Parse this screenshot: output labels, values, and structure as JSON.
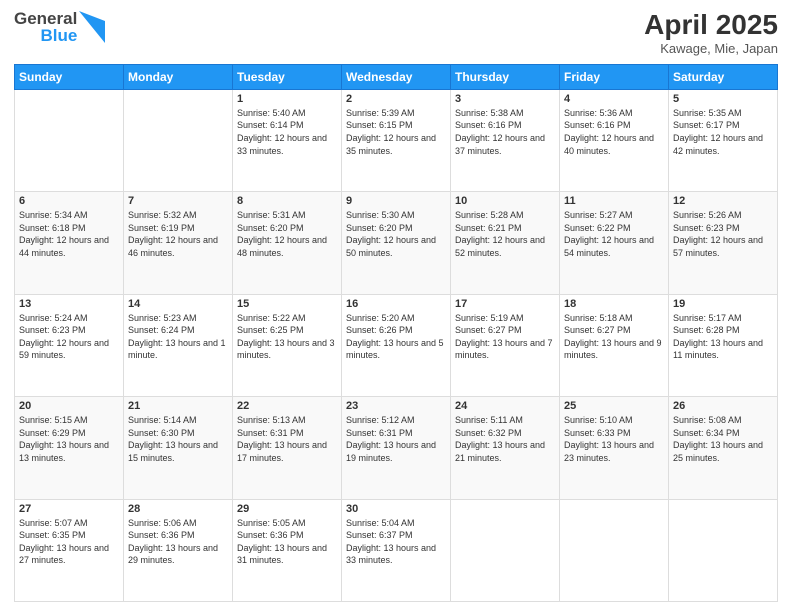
{
  "logo": {
    "general": "General",
    "blue": "Blue"
  },
  "title": "April 2025",
  "subtitle": "Kawage, Mie, Japan",
  "weekdays": [
    "Sunday",
    "Monday",
    "Tuesday",
    "Wednesday",
    "Thursday",
    "Friday",
    "Saturday"
  ],
  "weeks": [
    [
      {
        "day": "",
        "sunrise": "",
        "sunset": "",
        "daylight": ""
      },
      {
        "day": "",
        "sunrise": "",
        "sunset": "",
        "daylight": ""
      },
      {
        "day": "1",
        "sunrise": "Sunrise: 5:40 AM",
        "sunset": "Sunset: 6:14 PM",
        "daylight": "Daylight: 12 hours and 33 minutes."
      },
      {
        "day": "2",
        "sunrise": "Sunrise: 5:39 AM",
        "sunset": "Sunset: 6:15 PM",
        "daylight": "Daylight: 12 hours and 35 minutes."
      },
      {
        "day": "3",
        "sunrise": "Sunrise: 5:38 AM",
        "sunset": "Sunset: 6:16 PM",
        "daylight": "Daylight: 12 hours and 37 minutes."
      },
      {
        "day": "4",
        "sunrise": "Sunrise: 5:36 AM",
        "sunset": "Sunset: 6:16 PM",
        "daylight": "Daylight: 12 hours and 40 minutes."
      },
      {
        "day": "5",
        "sunrise": "Sunrise: 5:35 AM",
        "sunset": "Sunset: 6:17 PM",
        "daylight": "Daylight: 12 hours and 42 minutes."
      }
    ],
    [
      {
        "day": "6",
        "sunrise": "Sunrise: 5:34 AM",
        "sunset": "Sunset: 6:18 PM",
        "daylight": "Daylight: 12 hours and 44 minutes."
      },
      {
        "day": "7",
        "sunrise": "Sunrise: 5:32 AM",
        "sunset": "Sunset: 6:19 PM",
        "daylight": "Daylight: 12 hours and 46 minutes."
      },
      {
        "day": "8",
        "sunrise": "Sunrise: 5:31 AM",
        "sunset": "Sunset: 6:20 PM",
        "daylight": "Daylight: 12 hours and 48 minutes."
      },
      {
        "day": "9",
        "sunrise": "Sunrise: 5:30 AM",
        "sunset": "Sunset: 6:20 PM",
        "daylight": "Daylight: 12 hours and 50 minutes."
      },
      {
        "day": "10",
        "sunrise": "Sunrise: 5:28 AM",
        "sunset": "Sunset: 6:21 PM",
        "daylight": "Daylight: 12 hours and 52 minutes."
      },
      {
        "day": "11",
        "sunrise": "Sunrise: 5:27 AM",
        "sunset": "Sunset: 6:22 PM",
        "daylight": "Daylight: 12 hours and 54 minutes."
      },
      {
        "day": "12",
        "sunrise": "Sunrise: 5:26 AM",
        "sunset": "Sunset: 6:23 PM",
        "daylight": "Daylight: 12 hours and 57 minutes."
      }
    ],
    [
      {
        "day": "13",
        "sunrise": "Sunrise: 5:24 AM",
        "sunset": "Sunset: 6:23 PM",
        "daylight": "Daylight: 12 hours and 59 minutes."
      },
      {
        "day": "14",
        "sunrise": "Sunrise: 5:23 AM",
        "sunset": "Sunset: 6:24 PM",
        "daylight": "Daylight: 13 hours and 1 minute."
      },
      {
        "day": "15",
        "sunrise": "Sunrise: 5:22 AM",
        "sunset": "Sunset: 6:25 PM",
        "daylight": "Daylight: 13 hours and 3 minutes."
      },
      {
        "day": "16",
        "sunrise": "Sunrise: 5:20 AM",
        "sunset": "Sunset: 6:26 PM",
        "daylight": "Daylight: 13 hours and 5 minutes."
      },
      {
        "day": "17",
        "sunrise": "Sunrise: 5:19 AM",
        "sunset": "Sunset: 6:27 PM",
        "daylight": "Daylight: 13 hours and 7 minutes."
      },
      {
        "day": "18",
        "sunrise": "Sunrise: 5:18 AM",
        "sunset": "Sunset: 6:27 PM",
        "daylight": "Daylight: 13 hours and 9 minutes."
      },
      {
        "day": "19",
        "sunrise": "Sunrise: 5:17 AM",
        "sunset": "Sunset: 6:28 PM",
        "daylight": "Daylight: 13 hours and 11 minutes."
      }
    ],
    [
      {
        "day": "20",
        "sunrise": "Sunrise: 5:15 AM",
        "sunset": "Sunset: 6:29 PM",
        "daylight": "Daylight: 13 hours and 13 minutes."
      },
      {
        "day": "21",
        "sunrise": "Sunrise: 5:14 AM",
        "sunset": "Sunset: 6:30 PM",
        "daylight": "Daylight: 13 hours and 15 minutes."
      },
      {
        "day": "22",
        "sunrise": "Sunrise: 5:13 AM",
        "sunset": "Sunset: 6:31 PM",
        "daylight": "Daylight: 13 hours and 17 minutes."
      },
      {
        "day": "23",
        "sunrise": "Sunrise: 5:12 AM",
        "sunset": "Sunset: 6:31 PM",
        "daylight": "Daylight: 13 hours and 19 minutes."
      },
      {
        "day": "24",
        "sunrise": "Sunrise: 5:11 AM",
        "sunset": "Sunset: 6:32 PM",
        "daylight": "Daylight: 13 hours and 21 minutes."
      },
      {
        "day": "25",
        "sunrise": "Sunrise: 5:10 AM",
        "sunset": "Sunset: 6:33 PM",
        "daylight": "Daylight: 13 hours and 23 minutes."
      },
      {
        "day": "26",
        "sunrise": "Sunrise: 5:08 AM",
        "sunset": "Sunset: 6:34 PM",
        "daylight": "Daylight: 13 hours and 25 minutes."
      }
    ],
    [
      {
        "day": "27",
        "sunrise": "Sunrise: 5:07 AM",
        "sunset": "Sunset: 6:35 PM",
        "daylight": "Daylight: 13 hours and 27 minutes."
      },
      {
        "day": "28",
        "sunrise": "Sunrise: 5:06 AM",
        "sunset": "Sunset: 6:36 PM",
        "daylight": "Daylight: 13 hours and 29 minutes."
      },
      {
        "day": "29",
        "sunrise": "Sunrise: 5:05 AM",
        "sunset": "Sunset: 6:36 PM",
        "daylight": "Daylight: 13 hours and 31 minutes."
      },
      {
        "day": "30",
        "sunrise": "Sunrise: 5:04 AM",
        "sunset": "Sunset: 6:37 PM",
        "daylight": "Daylight: 13 hours and 33 minutes."
      },
      {
        "day": "",
        "sunrise": "",
        "sunset": "",
        "daylight": ""
      },
      {
        "day": "",
        "sunrise": "",
        "sunset": "",
        "daylight": ""
      },
      {
        "day": "",
        "sunrise": "",
        "sunset": "",
        "daylight": ""
      }
    ]
  ]
}
